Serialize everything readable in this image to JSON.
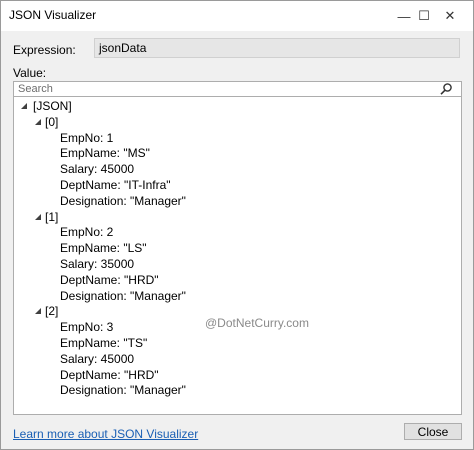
{
  "window": {
    "title": "JSON Visualizer",
    "minimize_glyph": "—",
    "maximize_glyph": "☐",
    "close_glyph": "✕"
  },
  "expression": {
    "label": "Expression:",
    "value": "jsonData"
  },
  "value_section": {
    "label": "Value:"
  },
  "search": {
    "placeholder": "Search"
  },
  "tree": {
    "root": "[JSON]",
    "items": [
      {
        "index": "[0]",
        "fields": [
          "EmpNo: 1",
          "EmpName: \"MS\"",
          "Salary: 45000",
          "DeptName: \"IT-Infra\"",
          "Designation: \"Manager\""
        ]
      },
      {
        "index": "[1]",
        "fields": [
          "EmpNo: 2",
          "EmpName: \"LS\"",
          "Salary: 35000",
          "DeptName: \"HRD\"",
          "Designation: \"Manager\""
        ]
      },
      {
        "index": "[2]",
        "fields": [
          "EmpNo: 3",
          "EmpName: \"TS\"",
          "Salary: 45000",
          "DeptName: \"HRD\"",
          "Designation: \"Manager\""
        ]
      }
    ]
  },
  "watermark": "@DotNetCurry.com",
  "footer": {
    "learn_more": "Learn more about JSON Visualizer",
    "close_label": "Close"
  }
}
